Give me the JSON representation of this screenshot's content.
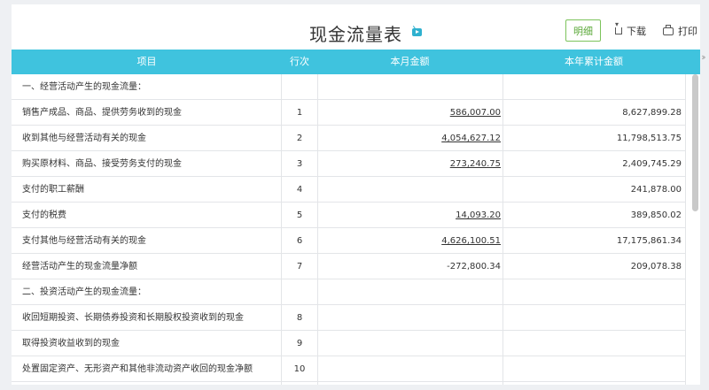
{
  "report": {
    "title": "现金流量表",
    "detail_label": "明细",
    "download_label": "下载",
    "print_label": "打印"
  },
  "table": {
    "headers": [
      "项目",
      "行次",
      "本月金额",
      "本年累计金额"
    ],
    "rows": [
      {
        "item": "一、经营活动产生的现金流量：",
        "no": "",
        "month": "",
        "year": "",
        "month_link": false
      },
      {
        "item": "销售产成品、商品、提供劳务收到的现金",
        "no": "1",
        "month": "586,007.00",
        "year": "8,627,899.28",
        "month_link": true
      },
      {
        "item": "收到其他与经营活动有关的现金",
        "no": "2",
        "month": "4,054,627.12",
        "year": "11,798,513.75",
        "month_link": true
      },
      {
        "item": "购买原材料、商品、接受劳务支付的现金",
        "no": "3",
        "month": "273,240.75",
        "year": "2,409,745.29",
        "month_link": true
      },
      {
        "item": "支付的职工薪酬",
        "no": "4",
        "month": "",
        "year": "241,878.00",
        "month_link": false
      },
      {
        "item": "支付的税费",
        "no": "5",
        "month": "14,093.20",
        "year": "389,850.02",
        "month_link": true
      },
      {
        "item": "支付其他与经营活动有关的现金",
        "no": "6",
        "month": "4,626,100.51",
        "year": "17,175,861.34",
        "month_link": true
      },
      {
        "item": "经营活动产生的现金流量净额",
        "no": "7",
        "month": "-272,800.34",
        "year": "209,078.38",
        "month_link": false
      },
      {
        "item": "二、投资活动产生的现金流量：",
        "no": "",
        "month": "",
        "year": "",
        "month_link": false
      },
      {
        "item": "收回短期投资、长期债券投资和长期股权投资收到的现金",
        "no": "8",
        "month": "",
        "year": "",
        "month_link": false
      },
      {
        "item": "取得投资收益收到的现金",
        "no": "9",
        "month": "",
        "year": "",
        "month_link": false
      },
      {
        "item": "处置固定资产、无形资产和其他非流动资产收回的现金净额",
        "no": "10",
        "month": "",
        "year": "",
        "month_link": false
      }
    ]
  },
  "colors": {
    "header_bg": "#3fc3de",
    "accent_green": "#5aa838"
  },
  "icons": [
    "tv-icon",
    "download-icon",
    "print-icon",
    "double-chevron-right-icon"
  ]
}
